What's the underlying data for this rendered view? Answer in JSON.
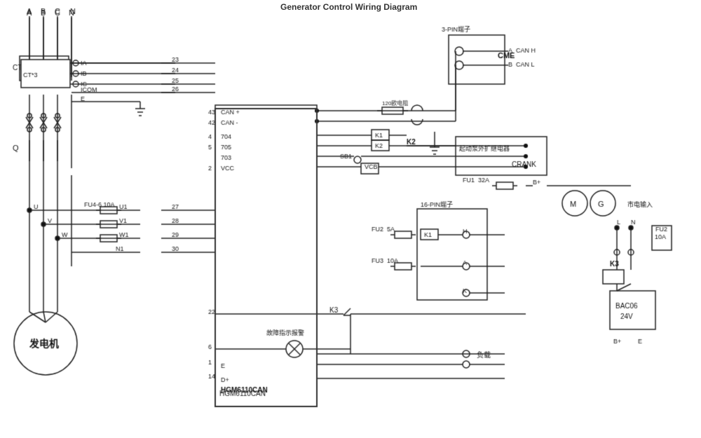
{
  "title": "Generator Control Wiring Diagram",
  "labels": {
    "phase_a": "A",
    "phase_b": "B",
    "phase_c": "C",
    "phase_n": "N",
    "ct": "CT*3",
    "ia": "IA",
    "ib": "IB",
    "ic": "IC",
    "icom": "ICOM",
    "e": "E",
    "q": "Q",
    "fu4_6": "FU4-6 10A",
    "u": "U",
    "v": "V",
    "w": "W",
    "u1": "U1",
    "v1": "V1",
    "w1": "W1",
    "n1": "N1",
    "pin27": "27",
    "pin28": "28",
    "pin29": "29",
    "pin30": "30",
    "pin23": "23",
    "pin24": "24",
    "pin25": "25",
    "pin26": "26",
    "generator": "发电机",
    "hgm": "HGM6110CAN",
    "can_plus": "CAN +",
    "can_minus": "CAN -",
    "pin43": "43",
    "pin42": "42",
    "pin4": "4",
    "pin5": "5",
    "pin2": "2",
    "pin22": "22",
    "pin6": "6",
    "pin1": "1",
    "pin14": "14",
    "pin703": "703",
    "pin704": "704",
    "pin705": "705",
    "vcc": "VCC",
    "dplus": "D+",
    "k1": "K1",
    "k2": "K2",
    "k3": "K3",
    "sb1": "SB1",
    "vcb": "VCB",
    "fu1": "FU1  32A",
    "fu2": "FU2  5A",
    "fu3": "FU3  10A",
    "bplus": "B+",
    "three_pin": "3-PIN端子",
    "sixteen_pin": "16-PIN端子",
    "can_h": "A  CAN H",
    "can_l": "B  CAN L",
    "r120": "120欧电阻",
    "expand": "起动泵外扩继电器",
    "crank": "CRANK",
    "h_pin": "H",
    "a_pin": "A",
    "k_pin": "K",
    "load": "负载",
    "fault": "故障指示报警",
    "bac06": "BAC06\n24V",
    "city_input": "市电输入",
    "city_l": "L",
    "city_n": "N",
    "city_fu": "FU2\n10A",
    "k3_right": "K3",
    "bplus_right": "B+",
    "e_right": "E",
    "motor_icon": "M",
    "gen_icon": "G",
    "cme": "CME"
  }
}
